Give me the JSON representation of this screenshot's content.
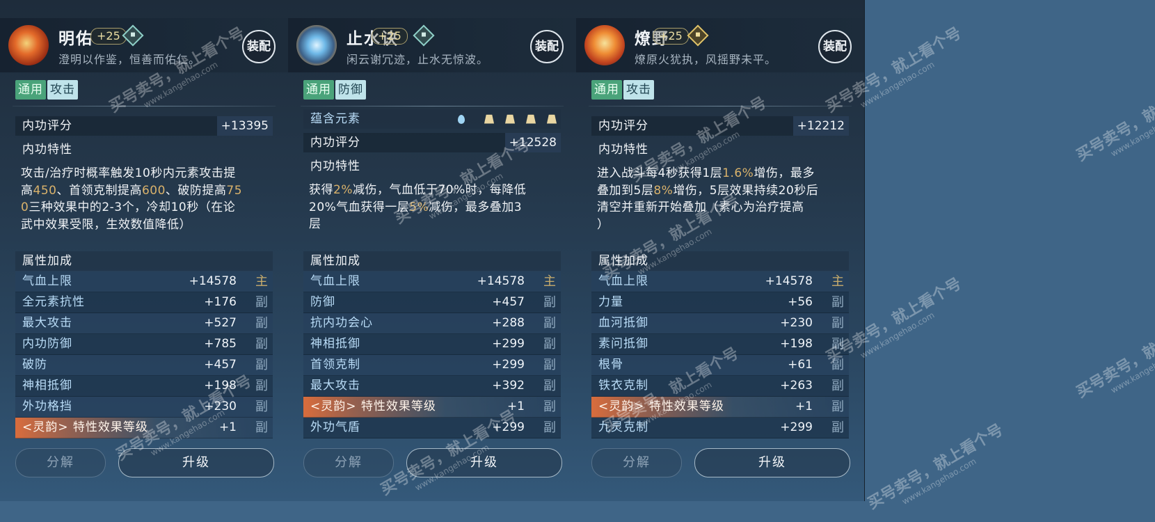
{
  "cards": [
    {
      "name": "明佑",
      "level": "+25",
      "motto": "澄明以作鉴，恒善而佑仁。",
      "equip": "装配",
      "tags": [
        "通用",
        "攻击"
      ],
      "score_label": "内功评分",
      "score": "+13395",
      "trait_label": "内功特性",
      "desc": [
        [
          {
            "t": "攻击/治疗时概率触发10秒内元素攻击提"
          }
        ],
        [
          {
            "t": "高"
          },
          {
            "t": "450",
            "h": 1
          },
          {
            "t": "、首领克制提高"
          },
          {
            "t": "600",
            "h": 1
          },
          {
            "t": "、破防提高"
          },
          {
            "t": "75",
            "h": 1
          }
        ],
        [
          {
            "t": "0",
            "h": 1
          },
          {
            "t": "三种效果中的2-3个，冷却10秒（在论"
          }
        ],
        [
          {
            "t": "武中效果受限，生效数值降低）"
          }
        ]
      ],
      "attr_label": "属性加成",
      "stats": [
        {
          "label": "气血上限",
          "value": "+14578",
          "mark": "主",
          "main": true
        },
        {
          "label": "全元素抗性",
          "value": "+176",
          "mark": "副"
        },
        {
          "label": "最大攻击",
          "value": "+527",
          "mark": "副"
        },
        {
          "label": "内功防御",
          "value": "+785",
          "mark": "副"
        },
        {
          "label": "破防",
          "value": "+457",
          "mark": "副"
        },
        {
          "label": "神相抵御",
          "value": "+198",
          "mark": "副"
        },
        {
          "label": "外功格挡",
          "value": "+230",
          "mark": "副"
        },
        {
          "label": "<灵韵> 特性效果等级",
          "value": "+1",
          "mark": "副",
          "special": true
        }
      ],
      "btn_disassemble": "分解",
      "btn_upgrade": "升级"
    },
    {
      "name": "止水诀",
      "level": "+25",
      "motto": "闲云谢冗迹，止水无惊波。",
      "equip": "装配",
      "tags": [
        "通用",
        "防御"
      ],
      "element_label": "蕴含元素",
      "score_label": "内功评分",
      "score": "+12528",
      "trait_label": "内功特性",
      "desc": [
        [
          {
            "t": "获得"
          },
          {
            "t": "2%",
            "h": 1
          },
          {
            "t": "减伤，气血低于70%时，每降低"
          }
        ],
        [
          {
            "t": "20%气血获得一层"
          },
          {
            "t": "5%",
            "h": 1
          },
          {
            "t": "减伤，最多叠加3"
          }
        ],
        [
          {
            "t": "层"
          }
        ]
      ],
      "attr_label": "属性加成",
      "stats": [
        {
          "label": "气血上限",
          "value": "+14578",
          "mark": "主",
          "main": true
        },
        {
          "label": "防御",
          "value": "+457",
          "mark": "副"
        },
        {
          "label": "抗内功会心",
          "value": "+288",
          "mark": "副"
        },
        {
          "label": "神相抵御",
          "value": "+299",
          "mark": "副"
        },
        {
          "label": "首领克制",
          "value": "+299",
          "mark": "副"
        },
        {
          "label": "最大攻击",
          "value": "+392",
          "mark": "副"
        },
        {
          "label": "<灵韵> 特性效果等级",
          "value": "+1",
          "mark": "副",
          "special": true
        },
        {
          "label": "外功气盾",
          "value": "+299",
          "mark": "副"
        }
      ],
      "btn_disassemble": "分解",
      "btn_upgrade": "升级"
    },
    {
      "name": "燎野",
      "level": "+25",
      "motto": "燎原火犹执，风摇野未平。",
      "equip": "装配",
      "tags": [
        "通用",
        "攻击"
      ],
      "score_label": "内功评分",
      "score": "+12212",
      "trait_label": "内功特性",
      "desc": [
        [
          {
            "t": "进入战斗每4秒获得1层"
          },
          {
            "t": "1.6%",
            "h": 1
          },
          {
            "t": "增伤，最多"
          }
        ],
        [
          {
            "t": "叠加到5层"
          },
          {
            "t": "8%",
            "h": 1
          },
          {
            "t": "增伤，5层效果持续20秒后"
          }
        ],
        [
          {
            "t": "清空并重新开始叠加（素心为治疗提高"
          }
        ],
        [
          {
            "t": "）"
          }
        ]
      ],
      "attr_label": "属性加成",
      "stats": [
        {
          "label": "气血上限",
          "value": "+14578",
          "mark": "主",
          "main": true
        },
        {
          "label": "力量",
          "value": "+56",
          "mark": "副"
        },
        {
          "label": "血河抵御",
          "value": "+230",
          "mark": "副"
        },
        {
          "label": "素问抵御",
          "value": "+198",
          "mark": "副"
        },
        {
          "label": "根骨",
          "value": "+61",
          "mark": "副"
        },
        {
          "label": "铁衣克制",
          "value": "+263",
          "mark": "副"
        },
        {
          "label": "<灵韵> 特性效果等级",
          "value": "+1",
          "mark": "副",
          "special": true
        },
        {
          "label": "九灵克制",
          "value": "+299",
          "mark": "副"
        }
      ],
      "btn_disassemble": "分解",
      "btn_upgrade": "升级"
    }
  ],
  "watermark": {
    "text": "买号卖号，就上看个号",
    "url": "www.kangehao.com"
  }
}
